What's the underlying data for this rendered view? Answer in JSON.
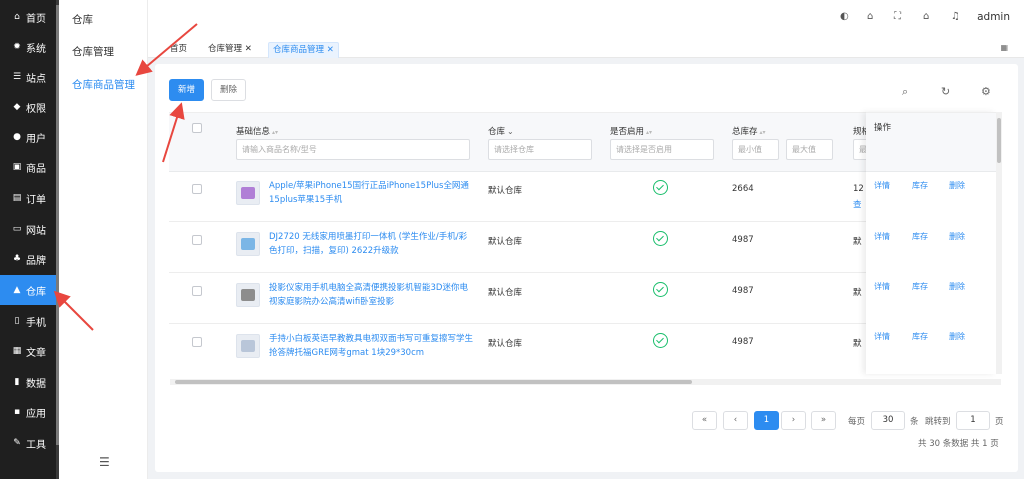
{
  "sidebar": {
    "items": [
      {
        "label": "首页",
        "icon": "home-icon",
        "glyph": "⌂"
      },
      {
        "label": "系统",
        "icon": "gear-icon",
        "glyph": "✹"
      },
      {
        "label": "站点",
        "icon": "sliders-icon",
        "glyph": "☰"
      },
      {
        "label": "权限",
        "icon": "user-lock-icon",
        "glyph": "◆"
      },
      {
        "label": "用户",
        "icon": "user-icon",
        "glyph": "●"
      },
      {
        "label": "商品",
        "icon": "goods-icon",
        "glyph": "▣"
      },
      {
        "label": "订单",
        "icon": "order-icon",
        "glyph": "▤"
      },
      {
        "label": "网站",
        "icon": "monitor-icon",
        "glyph": "▭"
      },
      {
        "label": "品牌",
        "icon": "brand-icon",
        "glyph": "♣"
      },
      {
        "label": "仓库",
        "icon": "warehouse-icon",
        "glyph": "▲",
        "active": true
      },
      {
        "label": "手机",
        "icon": "phone-icon",
        "glyph": "▯"
      },
      {
        "label": "文章",
        "icon": "article-icon",
        "glyph": "▦"
      },
      {
        "label": "数据",
        "icon": "bar-chart-icon",
        "glyph": "▮"
      },
      {
        "label": "应用",
        "icon": "apps-icon",
        "glyph": "▪"
      },
      {
        "label": "工具",
        "icon": "wrench-icon",
        "glyph": "✎"
      }
    ]
  },
  "submenu": {
    "title": "仓库",
    "items": [
      {
        "label": "仓库管理"
      },
      {
        "label": "仓库商品管理",
        "active": true
      }
    ],
    "fold_icon": "menu-fold-icon"
  },
  "header": {
    "icons": [
      "palette-icon",
      "bank-icon",
      "fullscreen-icon",
      "home-icon",
      "bell-icon"
    ],
    "user": "admin"
  },
  "tabs": {
    "items": [
      {
        "label": "首页"
      },
      {
        "label": "仓库管理 ✕"
      },
      {
        "label": "仓库商品管理 ✕",
        "active": true
      }
    ]
  },
  "toolbar": {
    "add_label": "新增",
    "delete_label": "删除"
  },
  "table": {
    "columns": {
      "info": "基础信息",
      "warehouse": "仓库",
      "enabled": "是否启用",
      "stock": "总库存",
      "spec": "规格",
      "action": "操作"
    },
    "filters": {
      "info_placeholder": "请输入商品名称/型号",
      "warehouse_placeholder": "请选择仓库",
      "enabled_placeholder": "请选择是否启用",
      "stock_min": "最小值",
      "stock_max": "最大值",
      "spec_placeholder": "最"
    },
    "rows": [
      {
        "name": "Apple/苹果iPhone15国行正品iPhone15Plus全网通15plus苹果15手机",
        "warehouse": "默认仓库",
        "stock": "2664",
        "spec": "12",
        "spec2": "查",
        "thumb_color": "#b07fd6"
      },
      {
        "name": "DJ2720 无线家用喷墨打印一体机 (学生作业/手机/彩色打印，扫描，复印) 2622升级款",
        "warehouse": "默认仓库",
        "stock": "4987",
        "spec": "默",
        "spec2": "",
        "thumb_color": "#7bb6e6"
      },
      {
        "name": "投影仪家用手机电脑全高清便携投影机智能3D迷你电视家庭影院办公高清wifi卧室投影",
        "warehouse": "默认仓库",
        "stock": "4987",
        "spec": "默",
        "spec2": "",
        "thumb_color": "#8d8d8d"
      },
      {
        "name": "手持小白板英语早教教具电视双面书写可重复擦写学生抢答牌托福GRE网考gmat 1块29*30cm",
        "warehouse": "默认仓库",
        "stock": "4987",
        "spec": "默",
        "spec2": "",
        "thumb_color": "#b9c6d9"
      }
    ],
    "ops": {
      "detail": "详情",
      "stock": "库存",
      "delete": "删除"
    }
  },
  "pagination": {
    "first": "«",
    "prev": "‹",
    "current": "1",
    "next": "›",
    "last": "»",
    "per_page_label": "每页",
    "per_page": "30",
    "unit": "条",
    "jump_label": "跳转到",
    "jump_page": "1",
    "page_unit": "页",
    "summary": "共 30 条数据  共 1 页"
  },
  "colors": {
    "accent": "#2d8cf0",
    "sidebar_bg": "#1f1f1f",
    "success": "#19be6b",
    "annotation": "#e8473f"
  }
}
